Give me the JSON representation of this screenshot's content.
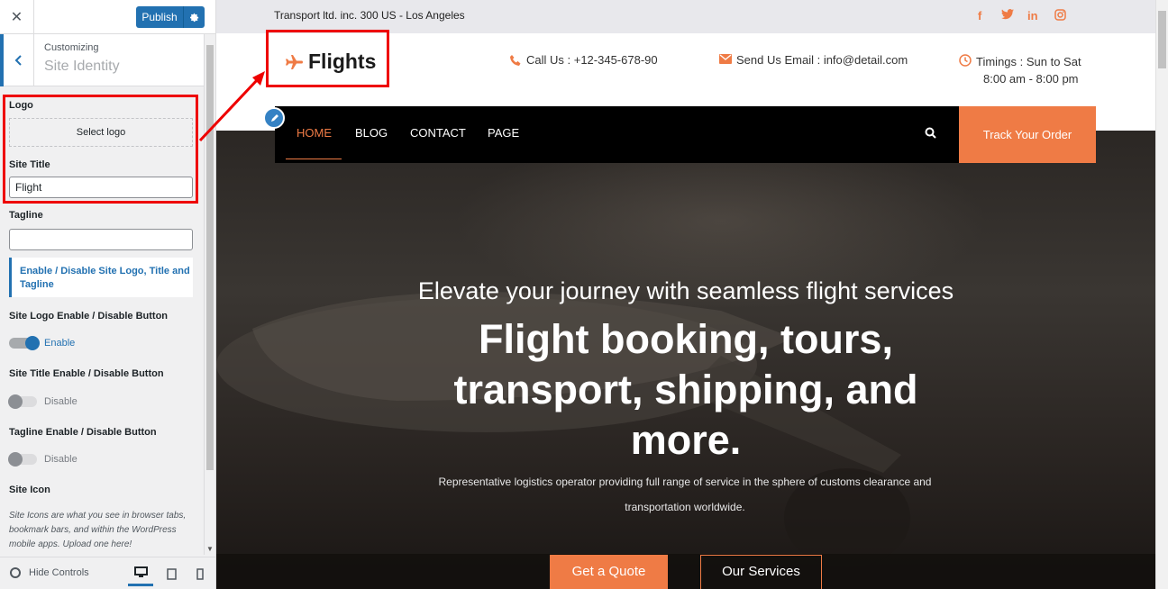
{
  "customizer": {
    "close_symbol": "✕",
    "publish_label": "Publish",
    "breadcrumb": "Customizing",
    "section_title": "Site Identity",
    "logo_label": "Logo",
    "select_logo": "Select logo",
    "site_title_label": "Site Title",
    "site_title_value": "Flight",
    "tagline_label": "Tagline",
    "tagline_value": "",
    "info_heading": "Enable / Disable Site Logo, Title and Tagline",
    "toggles": [
      {
        "label": "Site Logo Enable / Disable Button",
        "state": "Enable"
      },
      {
        "label": "Site Title Enable / Disable Button",
        "state": "Disable"
      },
      {
        "label": "Tagline Enable / Disable Button",
        "state": "Disable"
      }
    ],
    "site_icon_label": "Site Icon",
    "site_icon_desc": "Site Icons are what you see in browser tabs, bookmark bars, and within the WordPress mobile apps. Upload one here!",
    "hide_controls": "Hide Controls",
    "accent_color": "#2271b1"
  },
  "site": {
    "top_address": "Transport ltd. inc. 300 US - Los Angeles",
    "social": [
      "f",
      "t",
      "in",
      "ig"
    ],
    "logo_text": "Flights",
    "call_label": "Call Us : +12-345-678-90",
    "email_label": "Send Us Email : info@detail.com",
    "timings_line1": "Timings : Sun to Sat",
    "timings_line2": "8:00 am - 8:00 pm",
    "nav": [
      "HOME",
      "BLOG",
      "CONTACT",
      "PAGE"
    ],
    "track_order": "Track Your Order",
    "hero_subtitle": "Elevate your journey with seamless flight services",
    "hero_title": "Flight booking, tours, transport, shipping, and more.",
    "hero_description": "Representative logistics operator providing full range of service in the sphere of customs clearance and transportation worldwide.",
    "quote_button": "Get a Quote",
    "services_button": "Our Services",
    "accent_color": "#ef7b45"
  }
}
